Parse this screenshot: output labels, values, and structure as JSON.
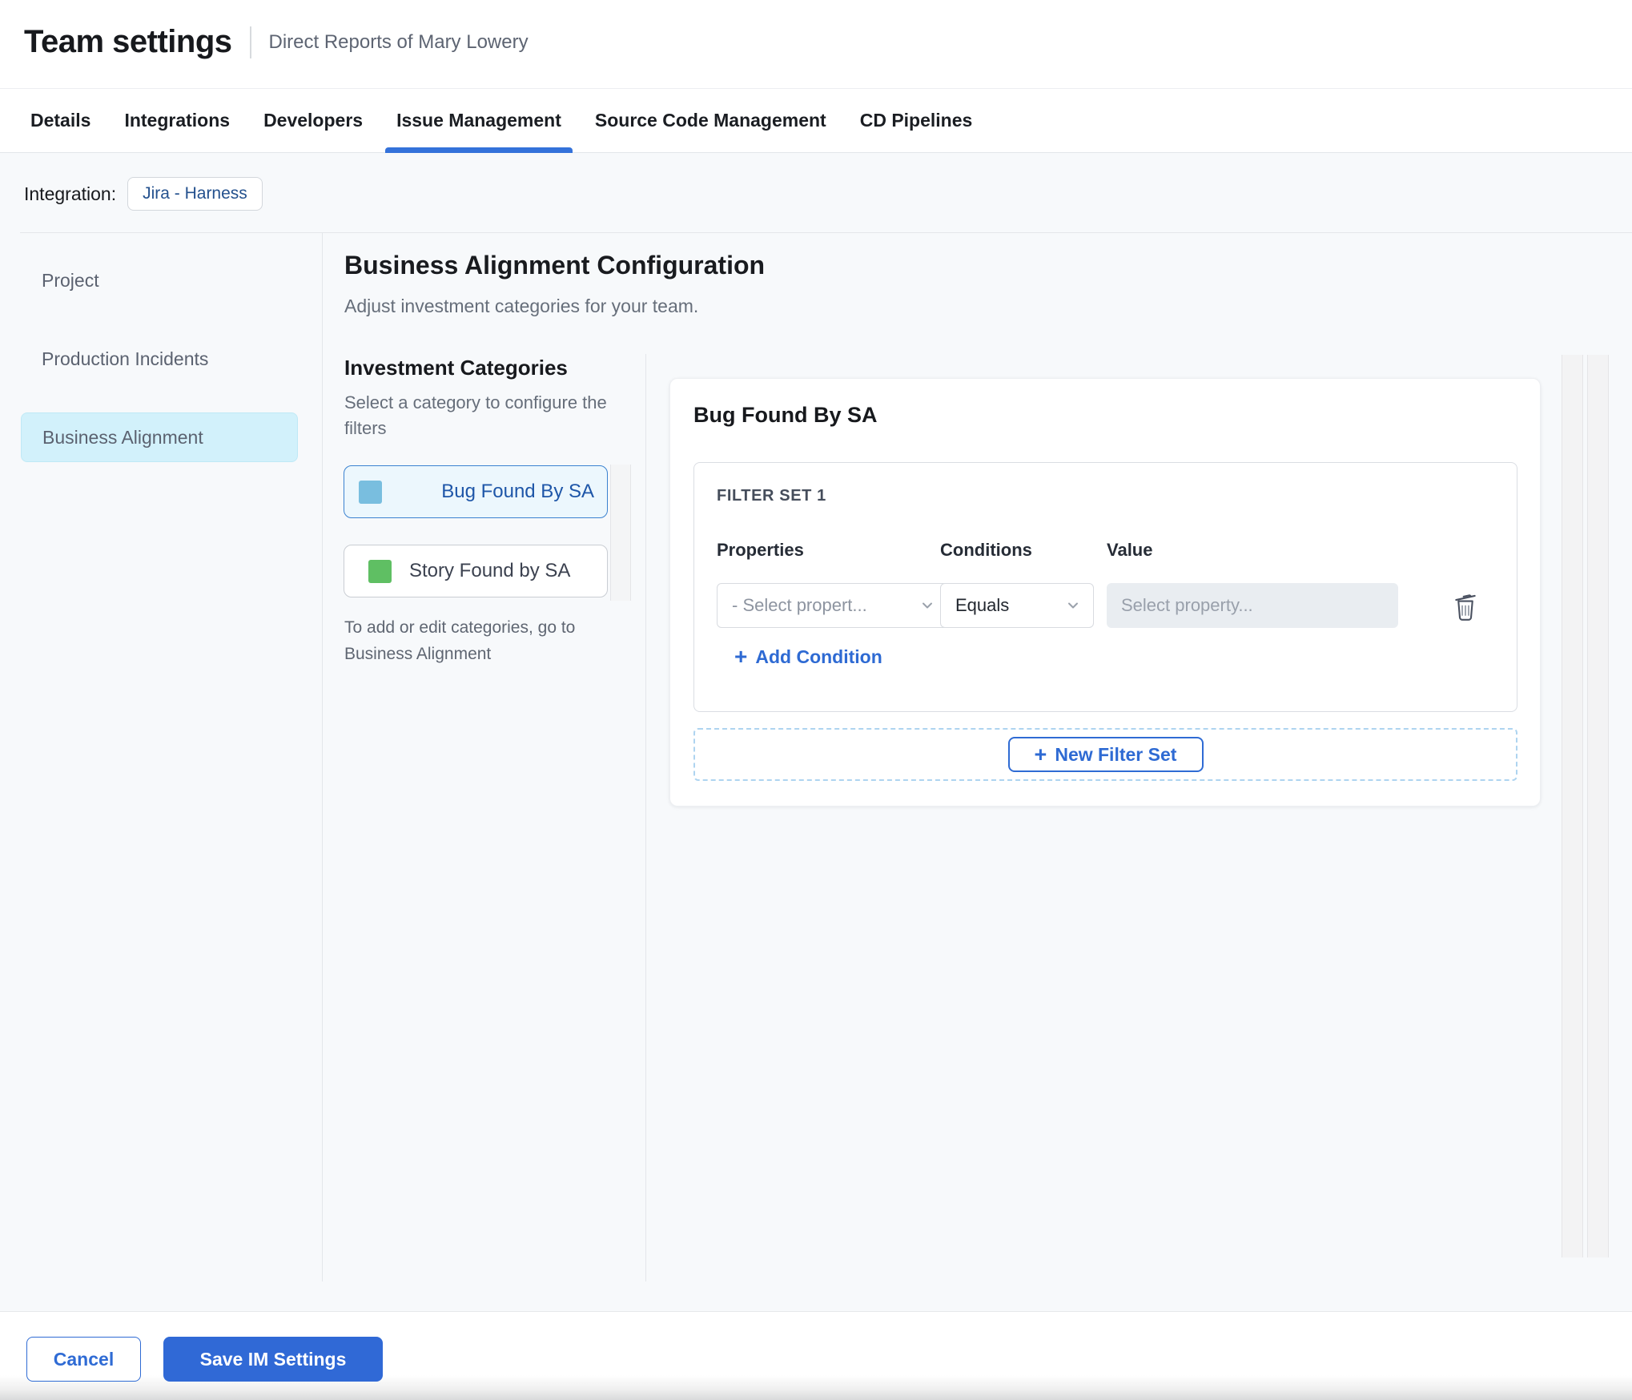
{
  "header": {
    "title": "Team settings",
    "subtitle": "Direct Reports of Mary Lowery"
  },
  "tabs": {
    "items": [
      {
        "label": "Details",
        "active": false
      },
      {
        "label": "Integrations",
        "active": false
      },
      {
        "label": "Developers",
        "active": false
      },
      {
        "label": "Issue Management",
        "active": true
      },
      {
        "label": "Source Code Management",
        "active": false
      },
      {
        "label": "CD Pipelines",
        "active": false
      }
    ]
  },
  "integration": {
    "label": "Integration:",
    "chip": "Jira - Harness"
  },
  "sidebar": {
    "items": [
      {
        "label": "Project",
        "active": false
      },
      {
        "label": "Production Incidents",
        "active": false
      },
      {
        "label": "Business Alignment",
        "active": true
      }
    ]
  },
  "main": {
    "title": "Business Alignment Configuration",
    "subtitle": "Adjust investment categories for your team.",
    "categories": {
      "title": "Investment Categories",
      "hint": "Select a category to configure the filters",
      "items": [
        {
          "label": "Bug Found By SA",
          "color": "#79bedf",
          "selected": true
        },
        {
          "label": "Story Found by SA",
          "color": "#5fbf63",
          "selected": false
        }
      ],
      "footnote": "To add or edit categories, go to Business Alignment"
    },
    "panel": {
      "title": "Bug Found By SA",
      "filter_set": {
        "title": "FILTER SET 1",
        "columns": [
          "Properties",
          "Conditions",
          "Value"
        ],
        "property_placeholder": "- Select propert...",
        "condition_value": "Equals",
        "value_placeholder": "Select property...",
        "add_condition_label": "Add Condition"
      },
      "new_filter_set_label": "New Filter Set"
    }
  },
  "footer": {
    "cancel_label": "Cancel",
    "save_label": "Save IM Settings"
  },
  "icons": {
    "plus": "+",
    "trash": "trash-can",
    "chevron": "chevron-down"
  },
  "colors": {
    "accent_blue": "#3069d6",
    "tab_underline": "#3472da",
    "sidebar_active_bg": "#d2f1fb",
    "category_selected_bg": "#ecf7fd",
    "category_selected_border": "#3b82d0",
    "category_bug_square": "#79bedf",
    "category_story_square": "#5fbf63",
    "dashed_border": "#aed4f0",
    "content_bg": "#f7f9fb"
  }
}
